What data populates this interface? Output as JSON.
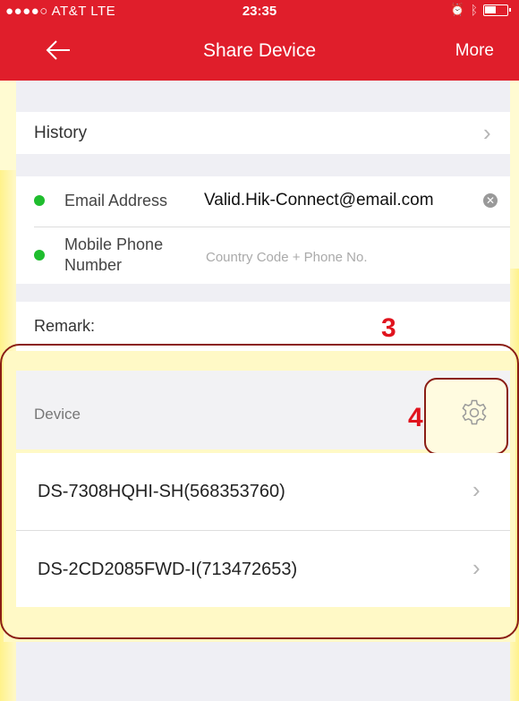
{
  "status_bar": {
    "carrier": "●●●●○ AT&T  LTE",
    "time": "23:35"
  },
  "nav": {
    "back_icon": "arrow-left-icon",
    "title": "Share Device",
    "more_label": "More"
  },
  "history": {
    "label": "History"
  },
  "contact": {
    "email_label": "Email Address",
    "email_value": "Valid.Hik-Connect@email.com",
    "phone_label_line1": "Mobile Phone",
    "phone_label_line2": "Number",
    "phone_placeholder": "Country Code + Phone No."
  },
  "remark": {
    "label": "Remark:"
  },
  "annotations": {
    "step3": "3",
    "step4": "4"
  },
  "device_section": {
    "header_label": "Device",
    "settings_icon": "gear-icon",
    "devices": [
      {
        "name": "DS-7308HQHI-SH(568353760)"
      },
      {
        "name": "DS-2CD2085FWD-I(713472653)"
      }
    ]
  },
  "colors": {
    "accent": "#e01e2b",
    "status_dot": "#1fbd2e",
    "highlight_frame": "#8a1d15",
    "highlight_glow": "#fff28a"
  }
}
